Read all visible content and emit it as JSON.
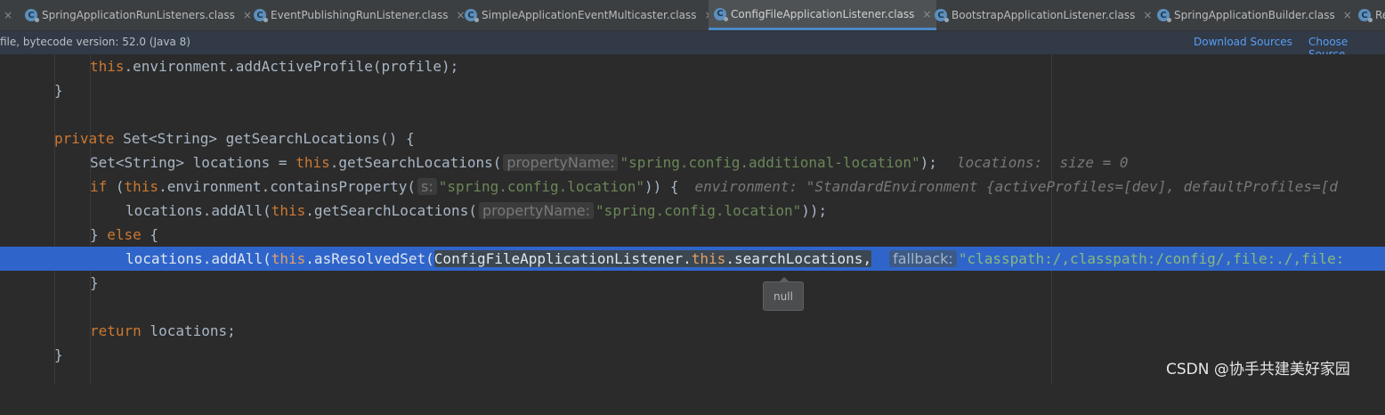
{
  "tabs": [
    {
      "label": "SpringApplicationRunListeners.class",
      "active": false
    },
    {
      "label": "EventPublishingRunListener.class",
      "active": false
    },
    {
      "label": "SimpleApplicationEventMulticaster.class",
      "active": false
    },
    {
      "label": "ConfigFileApplicationListener.class",
      "active": true
    },
    {
      "label": "BootstrapApplicationListener.class",
      "active": false
    },
    {
      "label": "SpringApplicationBuilder.class",
      "active": false
    },
    {
      "label": "Re",
      "active": false
    }
  ],
  "tab_close_glyph": "×",
  "tab_icon_letter": "C",
  "infobar": {
    "message": "file, bytecode version: 52.0 (Java 8)",
    "download_sources": "Download Sources",
    "choose_sources": "Choose Source"
  },
  "code": {
    "l1_this": "this",
    "l1_rest": ".environment.addActiveProfile(profile);",
    "l2": "}",
    "l4_private": "private",
    "l4_rest": " Set<String> getSearchLocations() {",
    "l5_a": "Set<String> locations = ",
    "l5_this": "this",
    "l5_b": ".getSearchLocations(",
    "l5_hint": "propertyName:",
    "l5_str": "\"spring.config.additional-location\"",
    "l5_c": ");",
    "l5_inline": "locations:  size = 0",
    "l6_if": "if",
    "l6_a": " (",
    "l6_this": "this",
    "l6_b": ".environment.containsProperty(",
    "l6_hint": "s:",
    "l6_str": "\"spring.config.location\"",
    "l6_c": ")) {",
    "l6_inline": "environment: \"StandardEnvironment {activeProfiles=[dev], defaultProfiles=[d",
    "l7_a": "locations.addAll(",
    "l7_this": "this",
    "l7_b": ".getSearchLocations(",
    "l7_hint": "propertyName:",
    "l7_str": "\"spring.config.location\"",
    "l7_c": "));",
    "l8_close": "} ",
    "l8_else": "else",
    "l8_open": " {",
    "l9_a": "locations.addAll(",
    "l9_this": "this",
    "l9_b": ".asResolvedSet(",
    "l9_arg1": "ConfigFileApplicationListener.",
    "l9_this2": "this",
    "l9_arg2": ".searchLocations,",
    "l9_hint": "fallback:",
    "l9_str": "\"classpath:/,classpath:/config/,file:./,file:",
    "l10": "}",
    "l12_return": "return",
    "l12_rest": " locations;",
    "l13": "}"
  },
  "tooltip": "null",
  "watermark": "CSDN @协手共建美好家园",
  "colors": {
    "background": "#2b2b2b",
    "selection": "#2f65ca",
    "keyword": "#cc7832",
    "string": "#6a8759",
    "link": "#589df6"
  }
}
